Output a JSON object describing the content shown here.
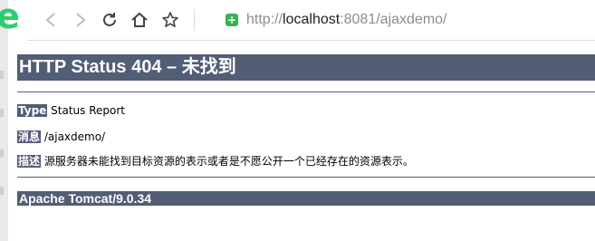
{
  "browser": {
    "logo_letter": "e",
    "url_prefix": "http://",
    "url_host": "localhost",
    "url_rest": ":8081/ajaxdemo/",
    "secure_glyph": "+",
    "icons": [
      "back-icon",
      "forward-icon",
      "reload-icon",
      "home-icon",
      "star-icon",
      "secure-icon"
    ]
  },
  "page": {
    "title": "HTTP Status 404 – 未找到",
    "type_label": "Type",
    "type_value": "Status Report",
    "message_label": "消息",
    "message_value": "/ajaxdemo/",
    "desc_label": "描述",
    "desc_value": "源服务器未能找到目标资源的表示或者是不愿公开一个已经存在的资源表示。",
    "footer": "Apache Tomcat/9.0.34"
  },
  "colors": {
    "heading_bg": "#525d76",
    "logo_green": "#2ecc71",
    "secure_green": "#31b553"
  }
}
